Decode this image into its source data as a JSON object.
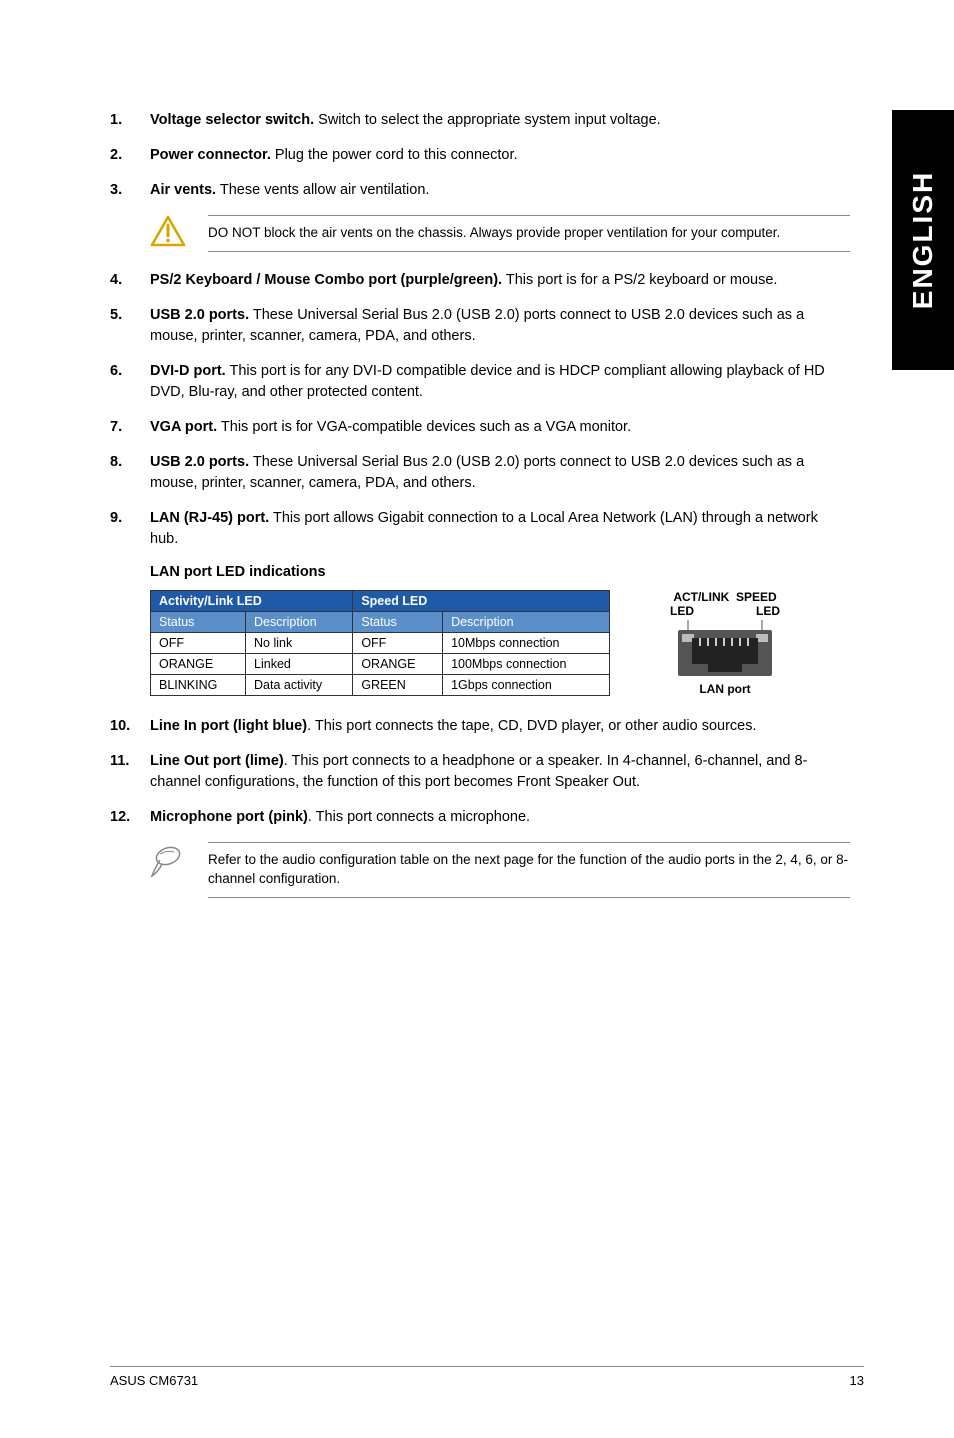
{
  "sideTab": "ENGLISH",
  "items": [
    {
      "n": "1.",
      "bold": "Voltage selector switch.",
      "text": " Switch to select the appropriate system input voltage."
    },
    {
      "n": "2.",
      "bold": "Power connector.",
      "text": " Plug the power cord to this connector."
    },
    {
      "n": "3.",
      "bold": "Air vents.",
      "text": " These vents allow air ventilation."
    }
  ],
  "callout1": "DO NOT block the air vents on the chassis. Always provide proper ventilation for your computer.",
  "items2": [
    {
      "n": "4.",
      "bold": "PS/2 Keyboard / Mouse Combo port (purple/green).",
      "text": " This port is for a PS/2 keyboard or mouse."
    },
    {
      "n": "5.",
      "bold": "USB 2.0 ports.",
      "text": " These Universal Serial Bus 2.0 (USB 2.0) ports connect to USB 2.0 devices such as a mouse, printer, scanner, camera, PDA, and others."
    },
    {
      "n": "6.",
      "bold": "DVI-D port.",
      "text": " This port is for any DVI-D compatible device and is HDCP compliant allowing playback of HD DVD, Blu-ray, and other protected content."
    },
    {
      "n": "7.",
      "bold": "VGA port.",
      "text": " This port is for VGA-compatible devices such as a VGA monitor."
    },
    {
      "n": "8.",
      "bold": "USB 2.0 ports.",
      "text": " These Universal Serial Bus 2.0 (USB 2.0) ports connect to USB 2.0 devices such as a mouse, printer, scanner, camera, PDA, and others."
    },
    {
      "n": "9.",
      "bold": "LAN (RJ-45) port.",
      "text": " This port allows Gigabit connection to a Local Area Network (LAN) through a network hub."
    }
  ],
  "ledHeading": "LAN port LED indications",
  "ledTable": {
    "group1": "Activity/Link LED",
    "group2": "Speed LED",
    "h1": "Status",
    "h2": "Description",
    "h3": "Status",
    "h4": "Description",
    "rows": [
      [
        "OFF",
        "No link",
        "OFF",
        "10Mbps connection"
      ],
      [
        "ORANGE",
        "Linked",
        "ORANGE",
        "100Mbps connection"
      ],
      [
        "BLINKING",
        "Data activity",
        "GREEN",
        "1Gbps connection"
      ]
    ]
  },
  "lanFig": {
    "title": "ACT/LINK",
    "title2": "SPEED",
    "led": "LED",
    "caption": "LAN port"
  },
  "items3": [
    {
      "n": "10.",
      "bold": "Line In port (light blue)",
      "text": ". This port connects the tape, CD, DVD player, or other audio sources."
    },
    {
      "n": "11.",
      "bold": "Line Out port (lime)",
      "text": ". This port connects to a headphone or a speaker. In 4-channel, 6-channel, and 8-channel configurations, the function of this port becomes Front Speaker Out."
    },
    {
      "n": "12.",
      "bold": "Microphone port (pink)",
      "text": ". This port connects a microphone."
    }
  ],
  "callout2": "Refer to the audio configuration table on the next page for the function of the audio ports in the 2, 4, 6, or 8-channel configuration.",
  "footer": {
    "left": "ASUS CM6731",
    "right": "13"
  }
}
